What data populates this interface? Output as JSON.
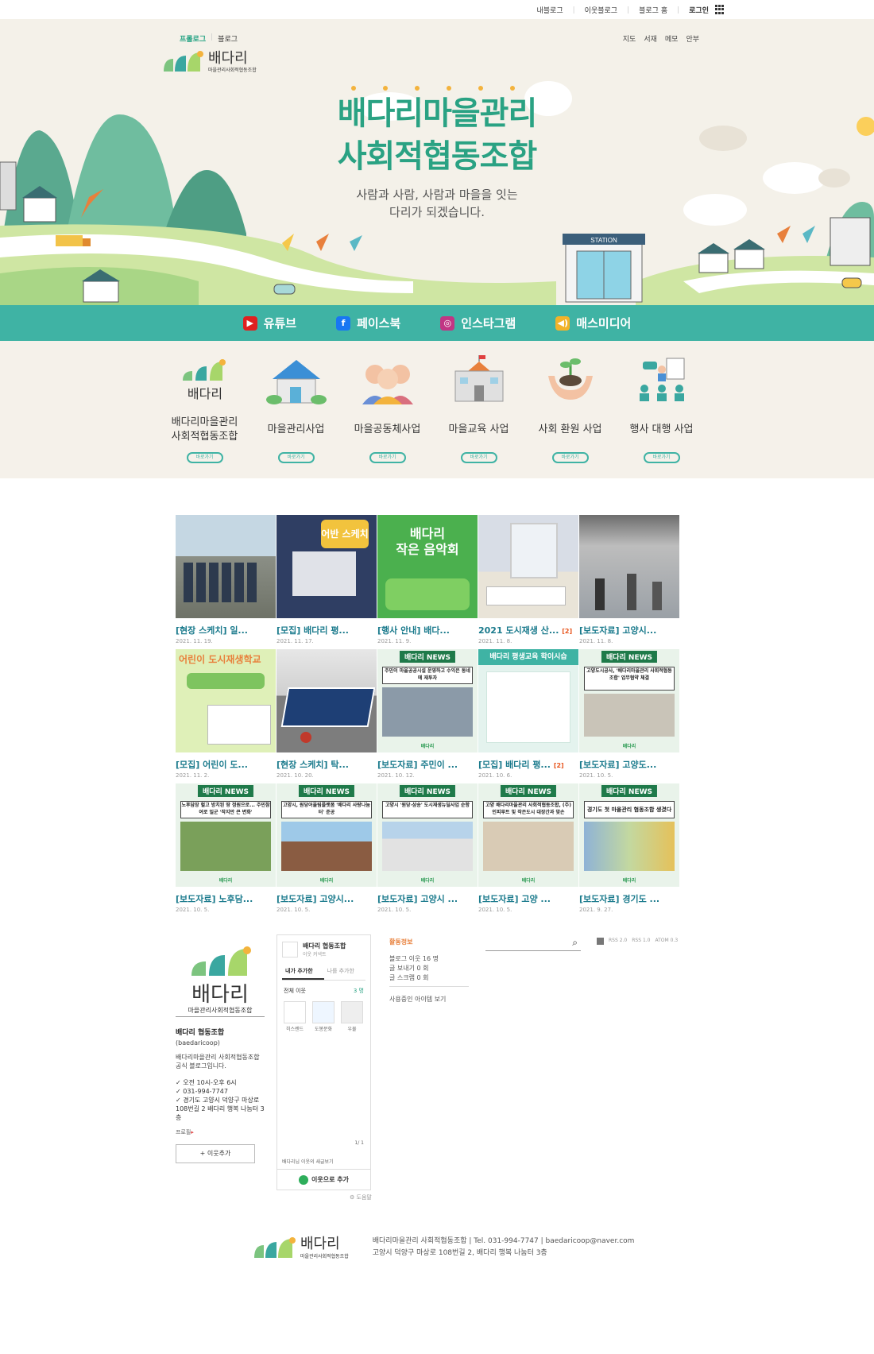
{
  "topnav": {
    "my_blog": "내블로그",
    "neighbor_blog": "이웃블로그",
    "blog_home": "블로그 홈",
    "login": "로그인"
  },
  "header": {
    "prologue": "프롤로그",
    "blog": "블로그",
    "links": [
      "지도",
      "서재",
      "메모",
      "안부"
    ],
    "logo_name": "배다리",
    "logo_sub": "마을관리사회적협동조합"
  },
  "hero": {
    "title_line1": "배다리마을관리",
    "title_line2": "사회적협동조합",
    "sub_line1": "사람과 사람, 사람과 마을을 잇는",
    "sub_line2": "다리가 되겠습니다.",
    "station": "STATION"
  },
  "social": [
    {
      "label": "유튜브",
      "icon": "youtube-icon",
      "color": "#e02020"
    },
    {
      "label": "페이스북",
      "icon": "facebook-icon",
      "color": "#1877f2"
    },
    {
      "label": "인스타그램",
      "icon": "instagram-icon",
      "color": "#c13584"
    },
    {
      "label": "매스미디어",
      "icon": "speaker-icon",
      "color": "#f2b32a"
    }
  ],
  "business": [
    {
      "label1": "배다리마을관리",
      "label2": "사회적협동조합",
      "btn": "바로가기"
    },
    {
      "label1": "마을관리사업",
      "label2": "",
      "btn": "바로가기"
    },
    {
      "label1": "마을공동체사업",
      "label2": "",
      "btn": "바로가기"
    },
    {
      "label1": "마을교육 사업",
      "label2": "",
      "btn": "바로가기"
    },
    {
      "label1": "사회 환원 사업",
      "label2": "",
      "btn": "바로가기"
    },
    {
      "label1": "행사 대행 사업",
      "label2": "",
      "btn": "바로가기"
    }
  ],
  "posts": [
    {
      "title": "[현장 스케치] 일...",
      "date": "2021. 11. 19.",
      "count": ""
    },
    {
      "title": "[모집] 배다리 평...",
      "date": "2021. 11. 17.",
      "count": ""
    },
    {
      "title": "[행사 안내] 배다...",
      "date": "2021. 11. 9.",
      "count": ""
    },
    {
      "title": "2021 도시재생 산...",
      "date": "2021. 11. 8.",
      "count": "[2]"
    },
    {
      "title": "[보도자료] 고양시...",
      "date": "2021. 11. 8.",
      "count": ""
    },
    {
      "title": "[모집] 어린이 도...",
      "date": "2021. 11. 2.",
      "count": ""
    },
    {
      "title": "[현장 스케치] 탁...",
      "date": "2021. 10. 20.",
      "count": ""
    },
    {
      "title": "[보도자료] 주민이 ...",
      "date": "2021. 10. 12.",
      "count": ""
    },
    {
      "title": "[모집] 배다리 평...",
      "date": "2021. 10. 6.",
      "count": "[2]"
    },
    {
      "title": "[보도자료] 고양도...",
      "date": "2021. 10. 5.",
      "count": ""
    },
    {
      "title": "[보도자료] 노후담...",
      "date": "2021. 10. 5.",
      "count": ""
    },
    {
      "title": "[보도자료] 고양시...",
      "date": "2021. 10. 5.",
      "count": ""
    },
    {
      "title": "[보도자료] 고양시 ...",
      "date": "2021. 10. 5.",
      "count": ""
    },
    {
      "title": "[보도자료] 고양 ...",
      "date": "2021. 10. 5.",
      "count": ""
    },
    {
      "title": "[보도자료] 경기도 ...",
      "date": "2021. 9. 27.",
      "count": ""
    }
  ],
  "thumbs": {
    "t1_title": "어반 스케치",
    "t2_line1": "배다리",
    "t2_line2": "작은 음악회",
    "t5_title": "어린이 도시재생학교",
    "news_tag": "배다리 NEWS",
    "news_foot": "배다리",
    "n8": "주민이 마을공공시설 운영하고 수익은 동네에 재투자",
    "n9": "배다리 평생교육 학이시습",
    "n10": "고양도시공사, '배다리마을관리 사회적협동조합' 업무협약 체결",
    "n11": "노후담장 헐고 방치된 땅 정원으로... 주민참여로 일군 '작지만 큰 변화'",
    "n12": "고양시, 원당어울림플랫폼 '배다리 사랑나눔터' 준공",
    "n13": "고양시 '원당·삼송' 도시재생뉴딜사업 순항",
    "n14": "고양 배다리마을관리 사회적협동조합, (주)인피루트 및 작은도시 대장간과 맞손",
    "n15": "경기도 첫 마을관리 협동조합 생겼다"
  },
  "profile": {
    "name": "배다리 협동조합",
    "id": "(baedaricoop)",
    "desc": "배다리마을관리 사회적협동조합 공식 블로그입니다.",
    "info": [
      "✓ 오전 10시-오후 6시",
      "✓ 031-994-7747",
      "✓ 경기도 고양시 덕양구 마상로108번길 2 배다리 행복 나눔터 3층"
    ],
    "profile_link": "프로필",
    "add_btn": "+ 이웃추가"
  },
  "neighbor": {
    "title": "배다리 협동조합",
    "sub": "이웃 커넥트",
    "tab1": "내가 추가한",
    "tab2": "나를 추가한",
    "all": "전체 이웃",
    "count": "3 명",
    "friends": [
      "히스렌드",
      "도봉문화",
      "우물"
    ],
    "page": "1/ 1",
    "new_posts": "배다리님 이웃의 새글보기",
    "add_btn": "이웃으로 추가",
    "help": "도움말"
  },
  "activity": {
    "title": "활동정보",
    "line1": "블로그 이웃 16 명",
    "line2": "글 보내기 0 회",
    "line3": "글 스크랩 0 회",
    "items": "사용중인 아이템 보기"
  },
  "rss": [
    "RSS 2.0",
    "RSS 1.0",
    "ATOM 0.3"
  ],
  "footer": {
    "line1": "배다리마을관리 사회적협동조합  |  Tel. 031-994-7747  |  baedaricoop@naver.com",
    "line2": "고양시 덕양구 마상로 108번길 2, 배다리 행복 나눔터 3층"
  }
}
